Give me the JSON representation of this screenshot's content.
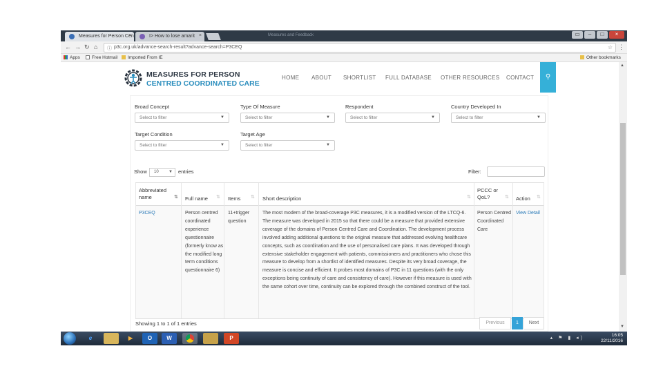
{
  "browser": {
    "tabs": [
      {
        "label": "Measures for Person Cen"
      },
      {
        "label": "I> How to lose amarit"
      }
    ],
    "title_text": "Measures and Feedback",
    "url": "p3c.org.uk/advance-search-result?advance-search=P3CEQ",
    "bookmarks": [
      {
        "label": "Apps"
      },
      {
        "label": "Free Hotmail"
      },
      {
        "label": "Imported From IE"
      }
    ],
    "other_bookmarks": "Other bookmarks"
  },
  "site": {
    "logo_line1": "MEASURES FOR PERSON",
    "logo_line2": "CENTRED COORDINATED CARE",
    "nav": [
      {
        "label": "HOME"
      },
      {
        "label": "ABOUT"
      },
      {
        "label": "SHORTLIST"
      },
      {
        "label": "FULL DATABASE"
      },
      {
        "label": "OTHER RESOURCES"
      },
      {
        "label": "CONTACT"
      }
    ],
    "search_icon": "search-icon"
  },
  "filters": [
    {
      "label": "Broad Concept",
      "value": "Select to filter"
    },
    {
      "label": "Type Of Measure",
      "value": "Select to filter"
    },
    {
      "label": "Respondent",
      "value": "Select to filter"
    },
    {
      "label": "Country Developed In",
      "value": "Select to filter"
    },
    {
      "label": "Target Condition",
      "value": "Select to filter"
    },
    {
      "label": "Target Age",
      "value": "Select to filter"
    }
  ],
  "table_controls": {
    "show": "Show",
    "entries_value": "10",
    "entries": "entries",
    "filter_label": "Filter:"
  },
  "table": {
    "headers": [
      "Abbreviated name",
      "Full name",
      "Items",
      "Short description",
      "PCCC or QoL?",
      "Action"
    ],
    "rows": [
      {
        "abbrev": "P3CEQ",
        "full_name": "Person centred coordinated experience questionnaire (formerly know as the modified long term conditions questionnaire 6)",
        "items": "11+trigger question",
        "description": "The most modern of the broad-coverage P3C measures, it is a modified version of the LTCQ-6. The measure was developed in 2015 so that there could be a measure that provided extensive coverage of the domains of Person Centred Care and Coordination. The development process involved adding additional questions to the original measure that addressed evolving healthcare concepts, such as coordination and the use of personalised care plans. It was developed through extensive stakeholder engagement with patients, commissioners and practitioners who chose this measure to develop from a shortlist of identified measures. Despite its very broad coverage, the measure is concise and efficient. It probes most domains of P3C in 11 questions (with the only exceptions being continuity of care and consistency of care). However if this measure is used with the same cohort over time, continuity can be explored through the combined construct of the tool.",
        "pccc": "Person Centred Coordinated Care",
        "action": "View Detail"
      }
    ]
  },
  "footer": {
    "showing": "Showing 1 to 1 of 1 entries",
    "previous": "Previous",
    "page": "1",
    "next": "Next"
  },
  "taskbar": {
    "time": "16:05",
    "date": "22/11/2016"
  },
  "colors": {
    "accent": "#35b0d8",
    "link": "#2a7ab8",
    "logo_blue": "#2a8dbd"
  }
}
